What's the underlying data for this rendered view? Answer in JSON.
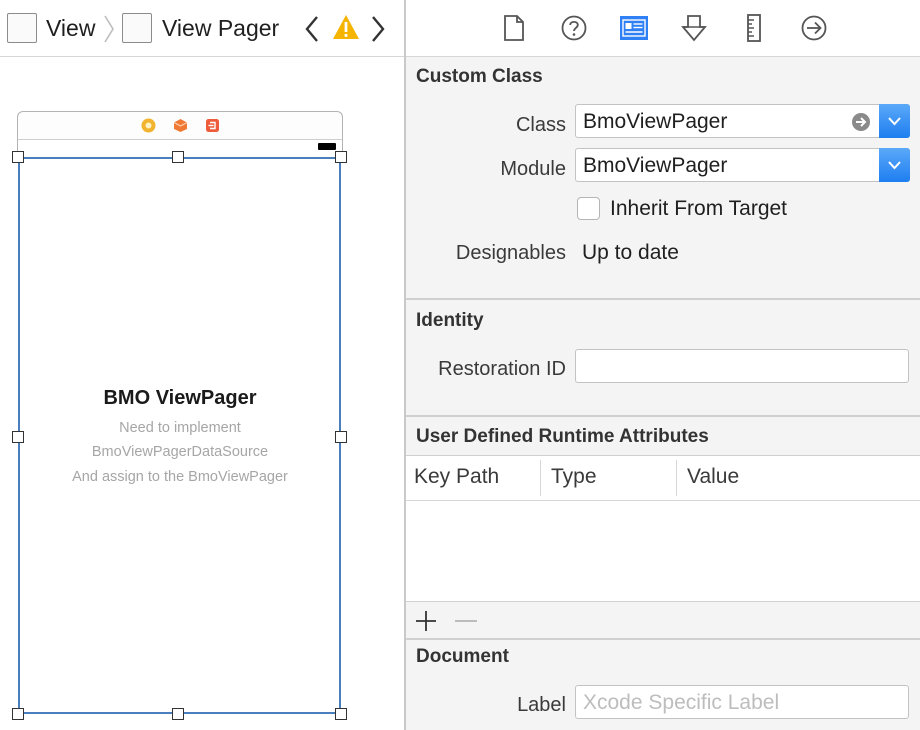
{
  "breadcrumb": {
    "items": [
      {
        "label": "View",
        "icon": "view-icon"
      },
      {
        "label": "View Pager",
        "icon": "view-icon"
      }
    ],
    "warning_color": "#f5b400"
  },
  "canvas": {
    "scene": {
      "dock_icons": [
        "view-controller-icon",
        "first-responder-icon",
        "exit-icon"
      ],
      "view": {
        "title": "BMO ViewPager",
        "subtitle_lines": [
          "Need to implement",
          "BmoViewPagerDataSource",
          "And assign to the BmoViewPager"
        ]
      }
    }
  },
  "inspector": {
    "toolbar_icons": [
      "file-inspector-icon",
      "quick-help-icon",
      "identity-inspector-icon",
      "attributes-inspector-icon",
      "size-inspector-icon",
      "connections-inspector-icon"
    ],
    "active_tab": "identity-inspector-icon",
    "accent_color": "#2f7ff5",
    "custom_class": {
      "title": "Custom Class",
      "class_label": "Class",
      "class_value": "BmoViewPager",
      "module_label": "Module",
      "module_value": "BmoViewPager",
      "inherit_label": "Inherit From Target",
      "inherit_checked": false,
      "designables_label": "Designables",
      "designables_value": "Up to date"
    },
    "identity": {
      "title": "Identity",
      "restoration_label": "Restoration ID",
      "restoration_value": ""
    },
    "runtime_attributes": {
      "title": "User Defined Runtime Attributes",
      "columns": [
        "Key Path",
        "Type",
        "Value"
      ],
      "rows": []
    },
    "document": {
      "title": "Document",
      "label_label": "Label",
      "label_placeholder": "Xcode Specific Label"
    }
  }
}
